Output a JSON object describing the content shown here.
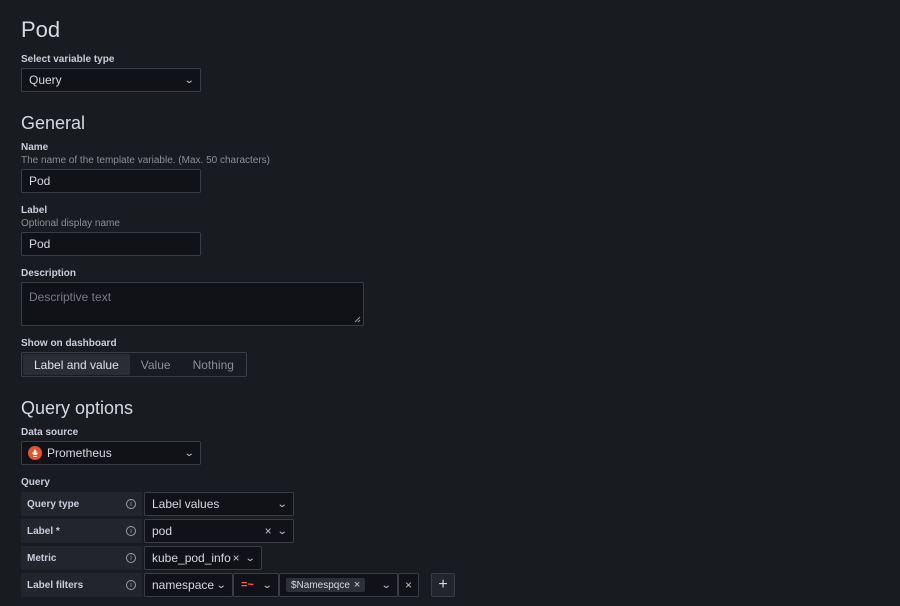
{
  "page": {
    "title": "Pod"
  },
  "variable_type": {
    "label": "Select variable type",
    "value": "Query"
  },
  "general": {
    "heading": "General",
    "name": {
      "label": "Name",
      "description": "The name of the template variable. (Max. 50 characters)",
      "value": "Pod"
    },
    "display_label": {
      "label": "Label",
      "description": "Optional display name",
      "value": "Pod"
    },
    "description": {
      "label": "Description",
      "placeholder": "Descriptive text"
    },
    "show_on_dashboard": {
      "label": "Show on dashboard",
      "options": [
        "Label and value",
        "Value",
        "Nothing"
      ],
      "selected": "Label and value"
    }
  },
  "query_options": {
    "heading": "Query options",
    "data_source": {
      "label": "Data source",
      "value": "Prometheus"
    },
    "query": {
      "label": "Query",
      "query_type": {
        "label": "Query type",
        "value": "Label values"
      },
      "label_field": {
        "label": "Label *",
        "value": "pod"
      },
      "metric": {
        "label": "Metric",
        "value": "kube_pod_info"
      },
      "label_filters": {
        "label": "Label filters",
        "key": "namespace",
        "operator": "=~",
        "value_tag": "$Namespqce"
      }
    }
  },
  "icons": {
    "info": "i",
    "chevron": "⌄",
    "clear": "×",
    "plus": "+"
  },
  "colors": {
    "background": "#181b1f",
    "input": "#111217",
    "prometheus": "#e6522c",
    "operator": "#ff5f4a"
  }
}
